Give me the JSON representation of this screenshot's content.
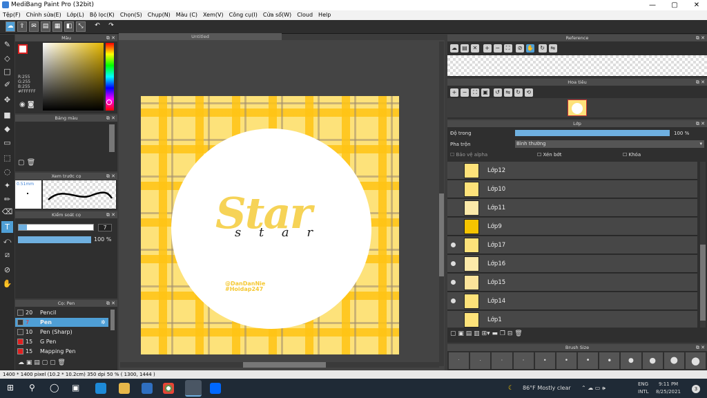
{
  "window": {
    "title": "MediBang Paint Pro (32bit)"
  },
  "menu": [
    "Tệp(F)",
    "Chỉnh sửa(E)",
    "Lớp(L)",
    "Bộ lọc(K)",
    "Chọn(S)",
    "Chụp(N)",
    "Màu (C)",
    "Xem(V)",
    "Công cụ(I)",
    "Cửa sổ(W)",
    "Cloud",
    "Help"
  ],
  "panels": {
    "color": "Màu",
    "palette": "Bảng màu",
    "brush_preview": "Xem trước cọ",
    "brush_control": "Kiểm soát cọ",
    "brush": "Cọ: Pen",
    "reference": "Reference",
    "navigator": "Hoa tiêu",
    "layer": "Lớp",
    "brush_size": "Brush Size"
  },
  "color": {
    "r": "R:255",
    "g": "G:255",
    "b": "B:255",
    "hex": "#FFFFFF",
    "hue_accent": "#ffd23c"
  },
  "brush_preview": {
    "size": "0.51mm"
  },
  "brush_control": {
    "size_value": "7",
    "opacity": "100 %"
  },
  "brushes": [
    {
      "size": "20",
      "name": "Pencil",
      "color": "#333333",
      "selected": false
    },
    {
      "size": "7",
      "name": "Pen",
      "color": "#333333",
      "selected": true
    },
    {
      "size": "10",
      "name": "Pen (Sharp)",
      "color": "#333333",
      "selected": false
    },
    {
      "size": "15",
      "name": "G Pen",
      "color": "#e02020",
      "selected": false
    },
    {
      "size": "15",
      "name": "Mapping Pen",
      "color": "#e02020",
      "selected": false
    }
  ],
  "canvas": {
    "tab": "Untitled",
    "art_word": "Star",
    "art_script": "s t a r",
    "credit1": "@DanDanNie",
    "credit2": "#Hoidap247"
  },
  "layer_panel": {
    "opacity_label": "Độ trong",
    "opacity_value": "100 %",
    "blend_label": "Pha trộn",
    "blend_value": "Bình thường",
    "protect_alpha": "Bảo vệ alpha",
    "clipping": "Xén bớt",
    "lock": "Khóa",
    "layers": [
      {
        "name": "Lớp12",
        "visible": false
      },
      {
        "name": "Lớp10",
        "visible": false
      },
      {
        "name": "Lớp11",
        "visible": false
      },
      {
        "name": "Lớp9",
        "visible": false
      },
      {
        "name": "Lớp17",
        "visible": true
      },
      {
        "name": "Lớp16",
        "visible": true
      },
      {
        "name": "Lớp15",
        "visible": true
      },
      {
        "name": "Lớp14",
        "visible": true
      },
      {
        "name": "Lớp1",
        "visible": false
      }
    ]
  },
  "brush_sizes": [
    "·",
    "·",
    "·",
    "·",
    "•",
    "•",
    "•",
    "•",
    "●",
    "●",
    "●",
    "●"
  ],
  "status": {
    "text": "1400 * 1400 pixel  (10.2 * 10.2cm)  350 dpi  50 %  ( 1300, 1444 )"
  },
  "taskbar": {
    "weather": "86°F  Mostly clear",
    "lang": "ENG",
    "lang2": "INTL",
    "time": "9:11 PM",
    "date": "8/25/2021",
    "badge": "3"
  }
}
